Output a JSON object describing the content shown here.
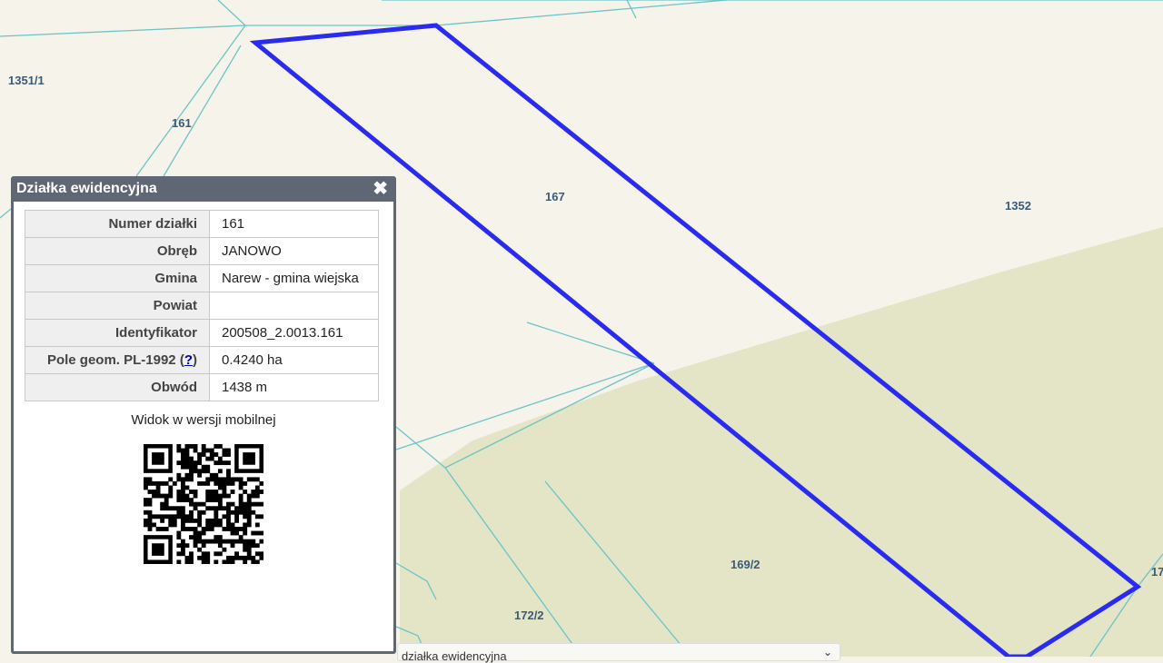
{
  "map": {
    "labels": [
      "1351/1",
      "161",
      "167",
      "1352",
      "169/2",
      "172/2",
      "17"
    ],
    "highlight_color": "#2b2bef",
    "line_color": "#6cc3c8"
  },
  "popup": {
    "title": "Działka ewidencyjna",
    "close_icon": "close-icon",
    "rows": [
      {
        "key": "Numer działki",
        "value": "161"
      },
      {
        "key": "Obręb",
        "value": "JANOWO"
      },
      {
        "key": "Gmina",
        "value": "Narew - gmina wiejska"
      },
      {
        "key": "Powiat",
        "value": ""
      },
      {
        "key": "Identyfikator",
        "value": "200508_2.0013.161"
      },
      {
        "key": "Pole geom. PL-1992 (",
        "help": "?",
        "key_end": ")",
        "value": "0.4240 ha"
      },
      {
        "key": "Obwód",
        "value": "1438 m"
      }
    ],
    "mobile_label": "Widok w wersji mobilnej"
  },
  "panel2": {
    "title": "działka ewidencyjna"
  }
}
